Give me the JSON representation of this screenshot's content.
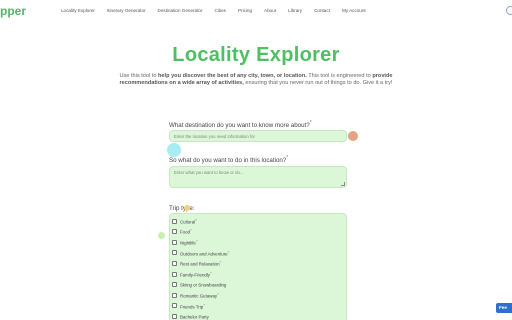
{
  "header": {
    "brand_fragment": "pper",
    "nav": [
      "Locality Explorer",
      "Itinerary Generator",
      "Destination Generator",
      "Cities",
      "Pricing",
      "About",
      "Library",
      "Contact",
      "My Account"
    ]
  },
  "page": {
    "title": "Locality Explorer",
    "intro": {
      "p1": "Use this tool to ",
      "b1": "help you discover the best of any city, town, or location.",
      "p2": " This tool is engineered to ",
      "b2": "provide recommendations on a wide array of activities,",
      "p3": " ensuring that you never run out of things to do. Give it a try!"
    }
  },
  "form": {
    "destination_label": "What destination do you want to know more about?",
    "destination_placeholder": "Enter the location you need information for",
    "activity_label": "So what do you want to do in this location?",
    "activity_placeholder": "Enter what you want to know or do...",
    "required_mark": "*",
    "trip_type_label": "Trip type:",
    "trip_types": [
      {
        "label": "Cultural",
        "mark": "?"
      },
      {
        "label": "Food",
        "mark": "?"
      },
      {
        "label": "Nightlife",
        "mark": "?"
      },
      {
        "label": "Outdoors and Adventure",
        "mark": "?"
      },
      {
        "label": "Rest and Relaxation",
        "mark": "?"
      },
      {
        "label": "Family-Friendly",
        "mark": "?"
      },
      {
        "label": "Skiing or Snowboarding",
        "mark": ""
      },
      {
        "label": "Romantic Getaway",
        "mark": "?"
      },
      {
        "label": "Friends Trip",
        "mark": "?"
      },
      {
        "label": "Bachelor Party",
        "mark": ""
      }
    ]
  },
  "widgets": {
    "feedback_label": "Fee"
  },
  "colors": {
    "accent": "#4fbf63",
    "field_bg": "#dcf6d8",
    "feedback_bg": "#2f6fd0"
  }
}
